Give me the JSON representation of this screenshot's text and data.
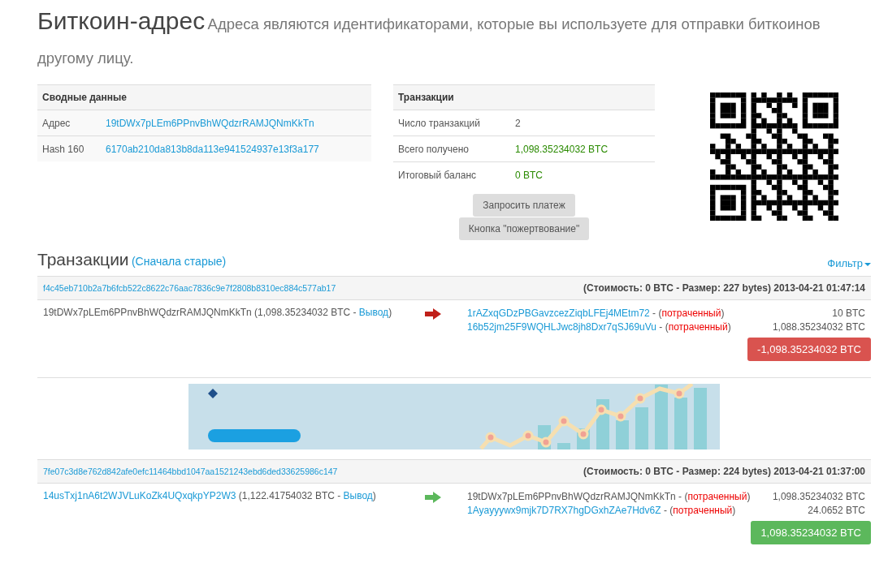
{
  "header": {
    "title": "Биткоин-адрес",
    "subtitle": "Адреса являются идентификаторами, которые вы используете для отправки биткоинов другому лицу."
  },
  "summary": {
    "heading": "Сводные данные",
    "rows": [
      {
        "label": "Адрес",
        "value": "19tDWx7pLEm6PPnvBhWQdzrRAMJQNmKkTn"
      },
      {
        "label": "Hash 160",
        "value": "6170ab210da813b8da113e941524937e13f3a177"
      }
    ]
  },
  "transactions_summary": {
    "heading": "Транзакции",
    "rows": [
      {
        "label": "Число транзакций",
        "value": "2",
        "kind": "plain"
      },
      {
        "label": "Всего получено",
        "value": "1,098.35234032 BTC",
        "kind": "amount"
      },
      {
        "label": "Итоговый баланс",
        "value": "0 BTC",
        "kind": "amount"
      }
    ]
  },
  "buttons": [
    "Запросить платеж",
    "Кнопка \"пожертвование\""
  ],
  "transactions_section": {
    "title": "Транзакции",
    "sort_link": "(Сначала старые)",
    "filter": "Фильтр"
  },
  "transactions": [
    {
      "hash": "f4c45eb710b2a7b6fcb522c8622c76aac7836c9e7f2808b8310ec884c577ab17",
      "meta": "(Стоимость: 0 BTC - Размер: 227 bytes) 2013-04-21 01:47:14",
      "input": {
        "address": "19tDWx7pLEm6PPnvBhWQdzrRAMJQNmKkTn",
        "link": false,
        "amount": "(1,098.35234032 BTC -",
        "output_link": "Вывод",
        "close": ")"
      },
      "kind": "outgoing",
      "outputs": [
        {
          "address": "1rAZxqGDzPBGavzcezZiqbLFEj4MEtm72",
          "link": true,
          "separator": "- (",
          "status": "потраченный",
          "close": ")",
          "amount": "10 BTC"
        },
        {
          "address": "16b52jm25F9WQHLJwc8jh8Dxr7qSJ69uVu",
          "link": true,
          "separator": "- (",
          "status": "потраченный",
          "close": ")",
          "amount": "1,088.35234032 BTC"
        }
      ],
      "result": {
        "text": "-1,098.35234032 BTC",
        "kind": "negative"
      }
    },
    {
      "hash": "7fe07c3d8e762d842afe0efc11464bbd1047aa1521243ebd6ded33625986c147",
      "meta": "(Стоимость: 0 BTC - Размер: 224 bytes) 2013-04-21 01:37:00",
      "input": {
        "address": "14usTxj1nA6t2WJVLuKoZk4UQxqkpYP2W3",
        "link": true,
        "amount": "(1,122.41754032 BTC -",
        "output_link": "Вывод",
        "close": ")"
      },
      "kind": "incoming",
      "outputs": [
        {
          "address": "19tDWx7pLEm6PPnvBhWQdzrRAMJQNmKkTn",
          "link": false,
          "separator": "- (",
          "status": "потраченный",
          "close": ")",
          "amount": "1,098.35234032 BTC"
        },
        {
          "address": "1Ayayyywx9mjk7D7RX7hgDGxhZAe7Hdv6Z",
          "link": true,
          "separator": "- (",
          "status": "потраченный",
          "close": ")",
          "amount": "24.0652 BTC"
        }
      ],
      "result": {
        "text": "1,098.35234032 BTC",
        "kind": "positive"
      }
    }
  ]
}
